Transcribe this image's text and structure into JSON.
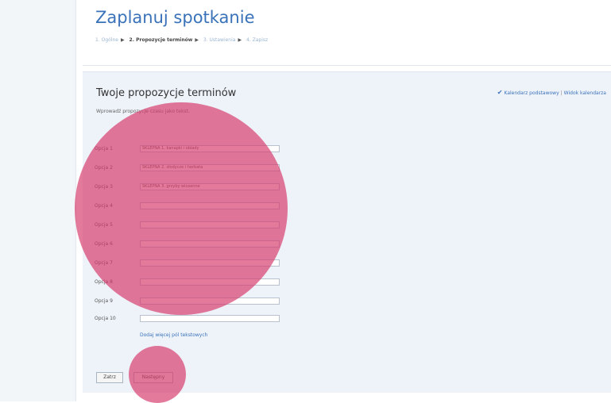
{
  "page_title": "Zaplanuj spotkanie",
  "steps": [
    {
      "label": "1. Ogólne"
    },
    {
      "label": "2. Propozycje terminów"
    },
    {
      "label": "3. Ustawienia"
    },
    {
      "label": "4. Zapisz"
    }
  ],
  "section_title": "Twoje propozycje terminów",
  "hint": "Wprowadź propozycje czasu jako tekst.",
  "calendar_links": {
    "primary": "Kalendarz podstawowy",
    "secondary": "Widok kalendarza"
  },
  "options": [
    {
      "label": "Opcja 1",
      "value": "SKLEPNA 1. kanapki i obiady"
    },
    {
      "label": "Opcja 2",
      "value": "SKLEPNA 2. słodycze i herbata"
    },
    {
      "label": "Opcja 3",
      "value": "SKLEPNA 3. grzyby wiosenne"
    },
    {
      "label": "Opcja 4",
      "value": ""
    },
    {
      "label": "Opcja 5",
      "value": ""
    },
    {
      "label": "Opcja 6",
      "value": ""
    },
    {
      "label": "Opcja 7",
      "value": ""
    },
    {
      "label": "Opcja 8",
      "value": ""
    },
    {
      "label": "Opcja 9",
      "value": ""
    },
    {
      "label": "Opcja 10",
      "value": ""
    }
  ],
  "more_fields_link": "Dodaj więcej pól tekstowych",
  "buttons": {
    "back": "Zatrz",
    "next": "Następny"
  },
  "colors": {
    "accent": "#3a72b9",
    "overlay": "#d63a6c"
  }
}
